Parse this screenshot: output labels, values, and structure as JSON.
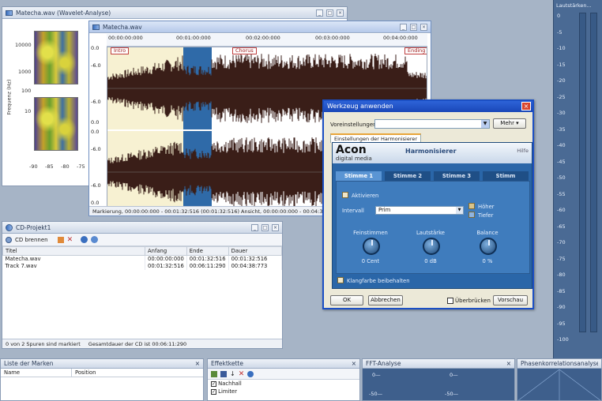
{
  "wavelet": {
    "title": "Matecha.wav (Wavelet-Analyse)",
    "ylabel": "Frequenz (Hz)",
    "yticks": [
      "10000",
      "1000",
      "100",
      "10"
    ],
    "xticks": [
      "-90",
      "-85",
      "-80",
      "-75"
    ]
  },
  "editor": {
    "title": "Matecha.wav",
    "timeline": [
      "00:00:00:000",
      "00:01:00:000",
      "00:02:00:000",
      "00:03:00:000",
      "00:04:00:000"
    ],
    "markers": [
      "Intro",
      "Chorus",
      "Ending"
    ],
    "yticks_top": [
      "0.0",
      "-6.0",
      "-6.0",
      "0.0"
    ],
    "yticks_bottom": [
      "0.0",
      "-6.0",
      "-6.0",
      "0.0"
    ],
    "status": "Markierung, 00:00:00:000 - 00:01:32:516 (00:01:32:516)  Ansicht, 00:00:00:000 - 00:04:38:773   C"
  },
  "cd": {
    "title": "CD-Projekt1",
    "burn_label": "CD brennen",
    "columns": [
      "Titel",
      "Anfang",
      "Ende",
      "Dauer"
    ],
    "rows": [
      [
        "Matecha.wav",
        "00:00:00:000",
        "00:01:32:516",
        "00:01:32:516"
      ],
      [
        "Track 7.wav",
        "00:01:32:516",
        "00:06:11:290",
        "00:04:38:773"
      ]
    ],
    "status_left": "0 von 2 Spuren sind markiert",
    "status_right": "Gesamtdauer der CD ist 00:06:11:290"
  },
  "meter": {
    "title": "Lautstärken...",
    "ticks": [
      "0",
      "-5",
      "-10",
      "-15",
      "-20",
      "-25",
      "-30",
      "-35",
      "-40",
      "-45",
      "-50",
      "-55",
      "-60",
      "-65",
      "-70",
      "-75",
      "-80",
      "-85",
      "-90",
      "-95",
      "-100"
    ]
  },
  "dialog": {
    "title": "Werkzeug anwenden",
    "preset_label": "Voreinstellungen:",
    "more_label": "Mehr",
    "tab_label": "Einstellungen der Harmonisierer",
    "brand": "Acon",
    "brand_sub": "digital media",
    "plugin_name": "Harmonisierer",
    "help": "Hilfe",
    "voices": [
      "Stimme 1",
      "Stimme 2",
      "Stimme 3",
      "Stimm"
    ],
    "activate": "Aktivieren",
    "interval_label": "Intervall",
    "interval_value": "Prim",
    "higher": "Höher",
    "lower": "Tiefer",
    "knobs": [
      {
        "label": "Feinstimmen",
        "value": "0 Cent"
      },
      {
        "label": "Lautstärke",
        "value": "0 dB"
      },
      {
        "label": "Balance",
        "value": "0 %"
      }
    ],
    "keep_timbre": "Klangfarbe beibehalten",
    "ok": "OK",
    "cancel": "Abbrechen",
    "bypass": "Überbrücken",
    "preview": "Vorschau"
  },
  "bottom": {
    "markers_title": "Liste der Marken",
    "markers_cols": [
      "Name",
      "Position"
    ],
    "chain_title": "Effektkette",
    "chain_items": [
      "Nachhall",
      "Limiter"
    ],
    "fft_title": "FFT-Analyse",
    "fft_ticks": [
      "0—",
      "-50—"
    ],
    "phase_title": "Phasenkorrelationsanalyse"
  }
}
